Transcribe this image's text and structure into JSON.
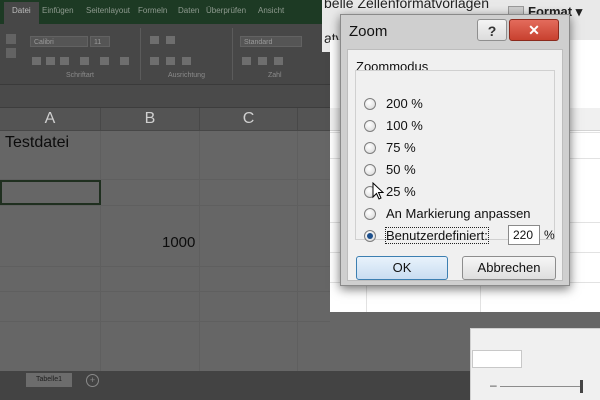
{
  "ribbon": {
    "tabs": [
      "Datei",
      "Einfügen",
      "Seitenlayout",
      "Formeln",
      "Daten",
      "Überprüfen",
      "Ansicht"
    ],
    "font_name": "Calibri",
    "font_size": "11",
    "number_format": "Standard",
    "groups": [
      "Schriftart",
      "Ausrichtung",
      "Zahl"
    ]
  },
  "toolbar_right": {
    "line1": "belle  Zellenformatvorlagen",
    "line2": "atvo",
    "format_label": "Format"
  },
  "sheet": {
    "columns": [
      "A",
      "B",
      "C"
    ],
    "cell_a1": "Testdatei",
    "cell_b3": "1000",
    "tab_name": "Tabelle1",
    "add_sheet": "+"
  },
  "dialog": {
    "title": "Zoom",
    "help": "?",
    "close": "✕",
    "group_label": "Zoommodus",
    "options": [
      {
        "label": "200 %",
        "selected": false
      },
      {
        "label": "100 %",
        "selected": false
      },
      {
        "label": "75 %",
        "selected": false
      },
      {
        "label": "50 %",
        "selected": false
      },
      {
        "label": "25 %",
        "selected": false
      },
      {
        "label": "An Markierung anpassen",
        "selected": false
      },
      {
        "label": "Benutzerdefiniert:",
        "selected": true
      }
    ],
    "custom_value": "220",
    "percent_sign": "%",
    "ok_label": "OK",
    "cancel_label": "Abbrechen"
  },
  "statusbar": {
    "zoom_minus": "–"
  },
  "colors": {
    "close_button": "#c8412f",
    "ok_border": "#3c7fb1",
    "dim_background": "#5a5a5a"
  }
}
